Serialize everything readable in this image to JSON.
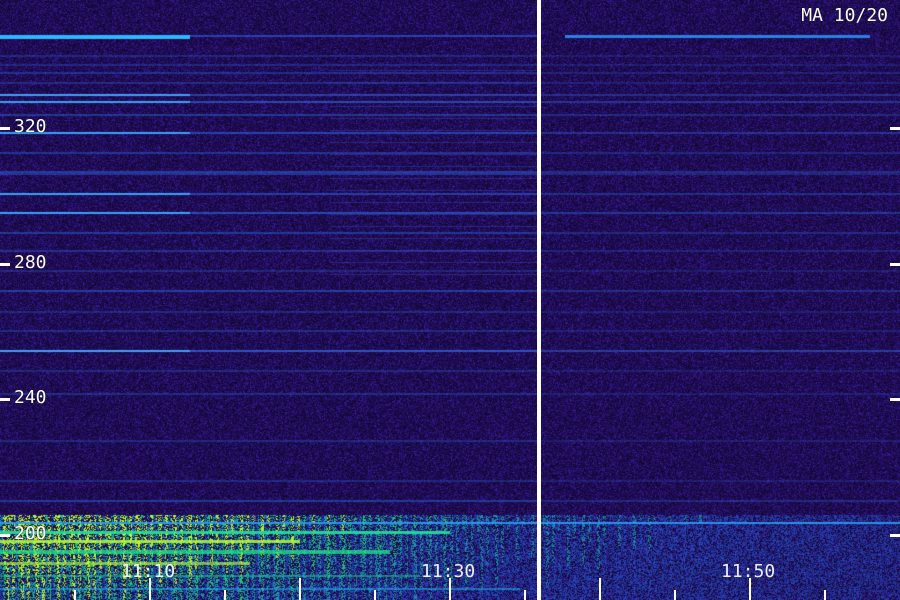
{
  "station_label": "MA 10/20",
  "y_axis": {
    "labels": [
      "320",
      "280",
      "240",
      "200"
    ]
  },
  "x_axis": {
    "labels": [
      "11:10",
      "11:30",
      "11:50"
    ]
  },
  "colors": {
    "background": "#200f52",
    "line_strong": "#3aa8ff",
    "line_mid": "#2f6ff0",
    "line_faint": "#3948c0",
    "green": "#1fe58a",
    "yellow_green": "#b7ff35",
    "cursor": "#ffffff",
    "tick": "#ffffff"
  }
}
